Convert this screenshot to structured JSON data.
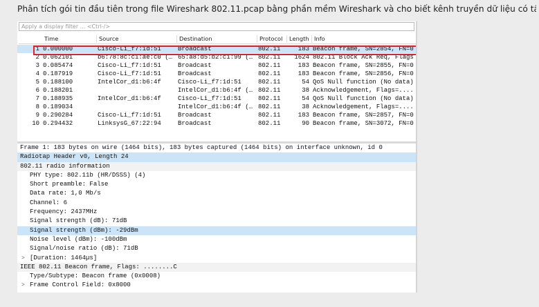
{
  "question": "Phân tích gói tin đầu tiên trong file Wireshark 802.11.pcap bằng phần mềm Wireshark và cho biết kênh truyền dữ liệu có tần số là bao nhiêu?",
  "filter": {
    "placeholder": "Apply a display filter ... <Ctrl-/>"
  },
  "columns": {
    "time": "Time",
    "source": "Source",
    "destination": "Destination",
    "protocol": "Protocol",
    "length": "Length",
    "info": "Info"
  },
  "packets": [
    {
      "no": "1",
      "time": "0.000000",
      "source": "Cisco-Li_f7:1d:51",
      "destination": "Broadcast",
      "protocol": "802.11",
      "length": "183",
      "info": "Beacon frame, SN=2854, FN=0"
    },
    {
      "no": "2",
      "time": "0.062101",
      "source": "b6:78:8c:c1:ae:c0 (…",
      "destination": "65:a8:d5:b2:c1:99 (…",
      "protocol": "802.11",
      "length": "1624",
      "info": "802.11 Block Ack Req, Flags"
    },
    {
      "no": "3",
      "time": "0.085474",
      "source": "Cisco-Li_f7:1d:51",
      "destination": "Broadcast",
      "protocol": "802.11",
      "length": "183",
      "info": "Beacon frame, SN=2855, FN=0"
    },
    {
      "no": "4",
      "time": "0.187919",
      "source": "Cisco-Li_f7:1d:51",
      "destination": "Broadcast",
      "protocol": "802.11",
      "length": "183",
      "info": "Beacon frame, SN=2856, FN=0"
    },
    {
      "no": "5",
      "time": "0.188100",
      "source": "IntelCor_d1:b6:4f",
      "destination": "Cisco-Li_f7:1d:51",
      "protocol": "802.11",
      "length": "54",
      "info": "QoS Null function (No data)"
    },
    {
      "no": "6",
      "time": "0.188201",
      "source": "",
      "destination": "IntelCor_d1:b6:4f (…",
      "protocol": "802.11",
      "length": "38",
      "info": "Acknowledgement, Flags=...."
    },
    {
      "no": "7",
      "time": "0.188935",
      "source": "IntelCor_d1:b6:4f",
      "destination": "Cisco-Li_f7:1d:51",
      "protocol": "802.11",
      "length": "54",
      "info": "QoS Null function (No data)"
    },
    {
      "no": "8",
      "time": "0.189034",
      "source": "",
      "destination": "IntelCor_d1:b6:4f (…",
      "protocol": "802.11",
      "length": "38",
      "info": "Acknowledgement, Flags=...."
    },
    {
      "no": "9",
      "time": "0.290284",
      "source": "Cisco-Li_f7:1d:51",
      "destination": "Broadcast",
      "protocol": "802.11",
      "length": "183",
      "info": "Beacon frame, SN=2857, FN=0"
    },
    {
      "no": "10",
      "time": "0.294432",
      "source": "LinksysG_67:22:94",
      "destination": "Broadcast",
      "protocol": "802.11",
      "length": "90",
      "info": "Beacon frame, SN=3072, FN=0"
    }
  ],
  "details": [
    {
      "text": "Frame 1: 183 bytes on wire (1464 bits), 183 bytes captured (1464 bits) on interface unknown, id 0",
      "indent": 0,
      "toggle": "",
      "style": ""
    },
    {
      "text": "Radiotap Header v0, Length 24",
      "indent": 0,
      "toggle": "",
      "style": "hl"
    },
    {
      "text": "802.11 radio information",
      "indent": 0,
      "toggle": "",
      "style": "grey"
    },
    {
      "text": "PHY type: 802.11b (HR/DSSS) (4)",
      "indent": 1,
      "toggle": "",
      "style": ""
    },
    {
      "text": "Short preamble: False",
      "indent": 1,
      "toggle": "",
      "style": ""
    },
    {
      "text": "Data rate: 1,0 Mb/s",
      "indent": 1,
      "toggle": "",
      "style": ""
    },
    {
      "text": "Channel: 6",
      "indent": 1,
      "toggle": "",
      "style": ""
    },
    {
      "text": "Frequency: 2437MHz",
      "indent": 1,
      "toggle": "",
      "style": ""
    },
    {
      "text": "Signal strength (dB): 71dB",
      "indent": 1,
      "toggle": "",
      "style": ""
    },
    {
      "text": "Signal strength (dBm): -29dBm",
      "indent": 1,
      "toggle": "",
      "style": "hl"
    },
    {
      "text": "Noise level (dBm): -100dBm",
      "indent": 1,
      "toggle": "",
      "style": ""
    },
    {
      "text": "Signal/noise ratio (dB): 71dB",
      "indent": 1,
      "toggle": "",
      "style": ""
    },
    {
      "text": "[Duration: 1464µs]",
      "indent": 1,
      "toggle": ">",
      "style": ""
    },
    {
      "text": "IEEE 802.11 Beacon frame, Flags: ........C",
      "indent": 0,
      "toggle": "",
      "style": "grey"
    },
    {
      "text": "Type/Subtype: Beacon frame (0x0008)",
      "indent": 1,
      "toggle": "",
      "style": ""
    },
    {
      "text": "Frame Control Field: 0x8000",
      "indent": 1,
      "toggle": ">",
      "style": ""
    }
  ]
}
